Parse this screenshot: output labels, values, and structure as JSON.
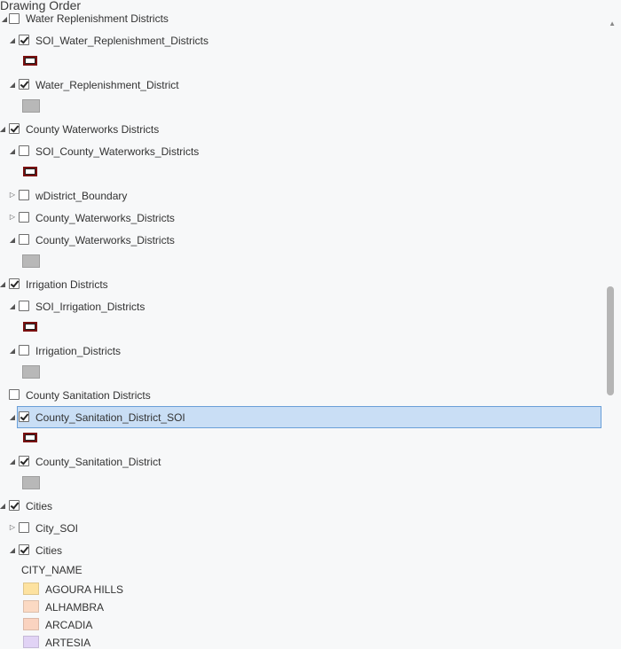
{
  "pane": {
    "title": "Drawing Order"
  },
  "layers": [
    {
      "id": "r0",
      "label": "Water Replenishment Districts",
      "checked": false,
      "expander": "expanded",
      "level": 0
    },
    {
      "id": "r1",
      "label": "SOI_Water_Replenishment_Districts",
      "checked": true,
      "expander": "expanded",
      "level": 1
    },
    {
      "id": "r2",
      "label": "Water_Replenishment_District",
      "checked": true,
      "expander": "expanded",
      "level": 1
    },
    {
      "id": "r3",
      "label": "County Waterworks Districts",
      "checked": true,
      "expander": "expanded",
      "level": 0
    },
    {
      "id": "r4",
      "label": "SOI_County_Waterworks_Districts",
      "checked": false,
      "expander": "expanded",
      "level": 1
    },
    {
      "id": "r5",
      "label": "wDistrict_Boundary",
      "checked": false,
      "expander": "collapsed",
      "level": 1
    },
    {
      "id": "r6",
      "label": "County_Waterworks_Districts",
      "checked": false,
      "expander": "collapsed",
      "level": 1
    },
    {
      "id": "r7",
      "label": "County_Waterworks_Districts",
      "checked": false,
      "expander": "expanded",
      "level": 1
    },
    {
      "id": "r8",
      "label": "Irrigation Districts",
      "checked": true,
      "expander": "expanded",
      "level": 0
    },
    {
      "id": "r9",
      "label": "SOI_Irrigation_Districts",
      "checked": false,
      "expander": "expanded",
      "level": 1
    },
    {
      "id": "r10",
      "label": "Irrigation_Districts",
      "checked": false,
      "expander": "expanded",
      "level": 1
    },
    {
      "id": "r11",
      "label": "County Sanitation Districts",
      "checked": false,
      "expander": "none",
      "level": 0
    },
    {
      "id": "r12",
      "label": "County_Sanitation_District_SOI",
      "checked": true,
      "expander": "expanded",
      "level": 1,
      "selected": true
    },
    {
      "id": "r13",
      "label": "County_Sanitation_District",
      "checked": true,
      "expander": "expanded",
      "level": 1
    },
    {
      "id": "r14",
      "label": "Cities",
      "checked": true,
      "expander": "expanded",
      "level": 0
    },
    {
      "id": "r15",
      "label": "City_SOI",
      "checked": false,
      "expander": "collapsed",
      "level": 1
    },
    {
      "id": "r16",
      "label": "Cities",
      "checked": true,
      "expander": "expanded",
      "level": 1
    }
  ],
  "symbols": {
    "outline": {
      "border_color": "#7a1010",
      "name": "outline-polygon-symbol"
    },
    "fill": {
      "color": "#b8b8b8",
      "name": "gray-fill-symbol"
    }
  },
  "cities_legend": {
    "field": "CITY_NAME",
    "classes": [
      {
        "name": "AGOURA HILLS",
        "color": "#fde2a0"
      },
      {
        "name": "ALHAMBRA",
        "color": "#fbd9c3"
      },
      {
        "name": "ARCADIA",
        "color": "#fad3c0"
      },
      {
        "name": "ARTESIA",
        "color": "#e1d3f5"
      }
    ]
  },
  "icons": {
    "expanded": "triangle-expanded-icon",
    "collapsed": "triangle-collapsed-icon",
    "scroll_up": "chevron-up-icon"
  }
}
